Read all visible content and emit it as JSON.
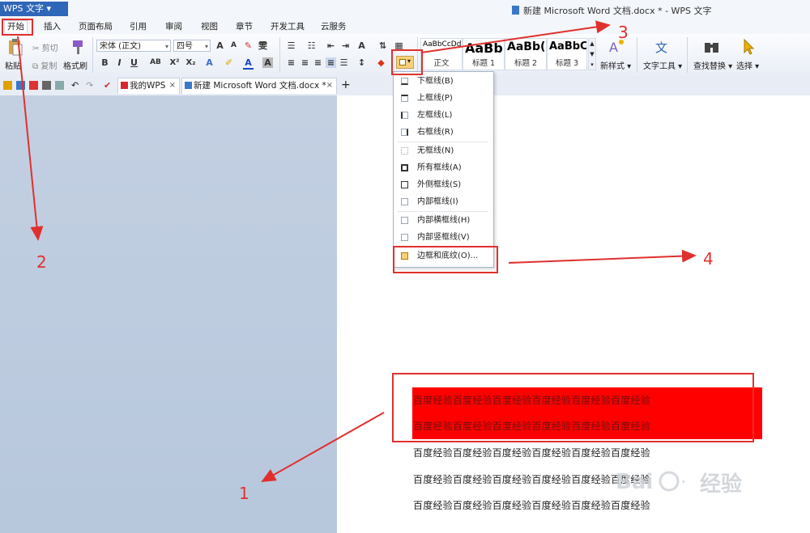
{
  "app_menu": "WPS 文字",
  "window_title": "新建 Microsoft Word 文档.docx * - WPS 文字",
  "menu_tabs": [
    "开始",
    "插入",
    "页面布局",
    "引用",
    "审阅",
    "视图",
    "章节",
    "开发工具",
    "云服务"
  ],
  "ribbon": {
    "paste": "粘贴",
    "cut": "剪切",
    "copy": "复制",
    "format_painter": "格式刷",
    "font_name": "宋体 (正文)",
    "font_size": "四号",
    "styles": [
      {
        "sample": "AaBbCcDd",
        "name": "正文"
      },
      {
        "sample": "AaBb",
        "name": "标题 1"
      },
      {
        "sample": "AaBb(",
        "name": "标题 2"
      },
      {
        "sample": "AaBbC",
        "name": "标题 3"
      }
    ],
    "new_style": "新样式",
    "text_tool": "文字工具",
    "find_replace": "查找替换",
    "select": "选择"
  },
  "doc_tabs": [
    {
      "label": "我的WPS"
    },
    {
      "label": "新建 Microsoft Word 文档.docx *"
    }
  ],
  "dropdown": {
    "items": [
      "下框线(B)",
      "上框线(P)",
      "左框线(L)",
      "右框线(R)",
      "无框线(N)",
      "所有框线(A)",
      "外侧框线(S)",
      "内部框线(I)",
      "内部横框线(H)",
      "内部竖框线(V)",
      "边框和底纹(O)..."
    ]
  },
  "document_lines": [
    "百度经验百度经验百度经验百度经验百度经验百度经验",
    "百度经验百度经验百度经验百度经验百度经验百度经验",
    "百度经验百度经验百度经验百度经验百度经验百度经验",
    "百度经验百度经验百度经验百度经验百度经验百度经验",
    "百度经验百度经验百度经验百度经验百度经验百度经验"
  ],
  "annotations": [
    "1",
    "2",
    "3",
    "4"
  ],
  "watermark": "经验",
  "colors": {
    "annotation_red": "#e0302e",
    "shading_red": "#ff0000",
    "app_blue": "#2e66b8"
  }
}
